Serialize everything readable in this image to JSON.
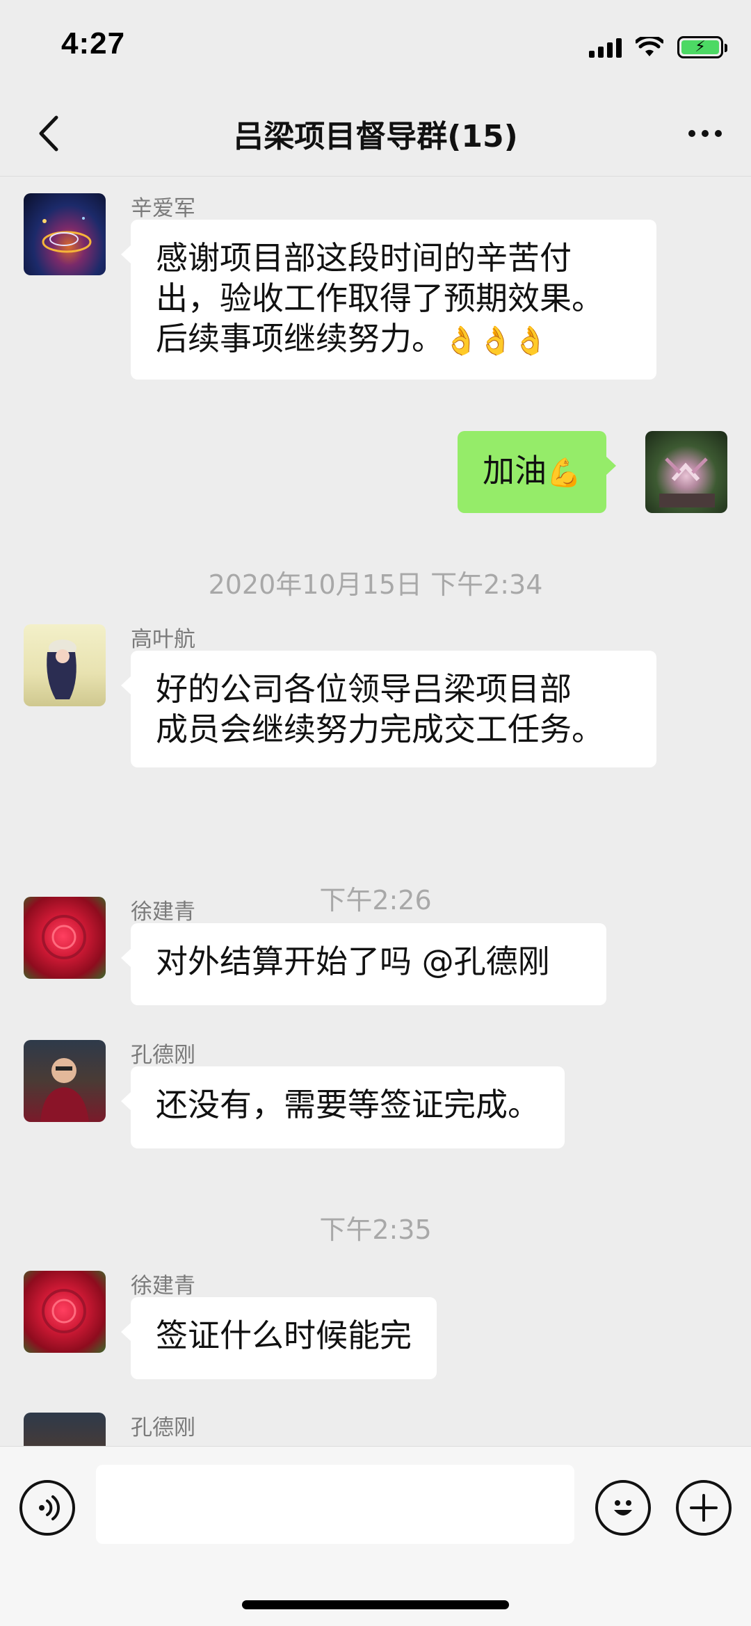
{
  "status_bar": {
    "time": "4:27",
    "battery_color": "#4cd964"
  },
  "nav": {
    "back_icon": "chevron-left-icon",
    "title": "吕梁项目督导群(15)",
    "more_icon": "more-dots-icon"
  },
  "messages": [
    {
      "side": "left",
      "sender": "辛爱军",
      "text_lines": [
        "感谢项目部这段时间的辛苦付",
        "出，验收工作取得了预期效果。",
        "后续事项继续努力。"
      ],
      "emoji": "👌👌👌"
    },
    {
      "side": "right",
      "text": "加油",
      "emoji": "💪"
    },
    {
      "side": "left",
      "sender": "高叶航",
      "text_lines": [
        "好的公司各位领导吕梁项目部",
        "成员会继续努力完成交工任务。"
      ]
    },
    {
      "side": "left",
      "sender": "徐建青",
      "text": "对外结算开始了吗 @孔德刚"
    },
    {
      "side": "left",
      "sender": "孔德刚",
      "text": "还没有，需要等签证完成。"
    },
    {
      "side": "left",
      "sender": "徐建青",
      "text": "签证什么时候能完"
    },
    {
      "side": "left",
      "sender": "孔德刚"
    }
  ],
  "timestamps": [
    "2020年10月15日 下午2:34",
    "下午2:26",
    "下午2:35"
  ],
  "input_bar": {
    "voice_icon": "voice-icon",
    "emoji_icon": "emoji-smile-icon",
    "plus_icon": "plus-icon",
    "input_value": ""
  },
  "colors": {
    "background": "#ededed",
    "sent_bubble": "#95ec69",
    "received_bubble": "#ffffff",
    "timestamp": "#a8a8a8"
  }
}
